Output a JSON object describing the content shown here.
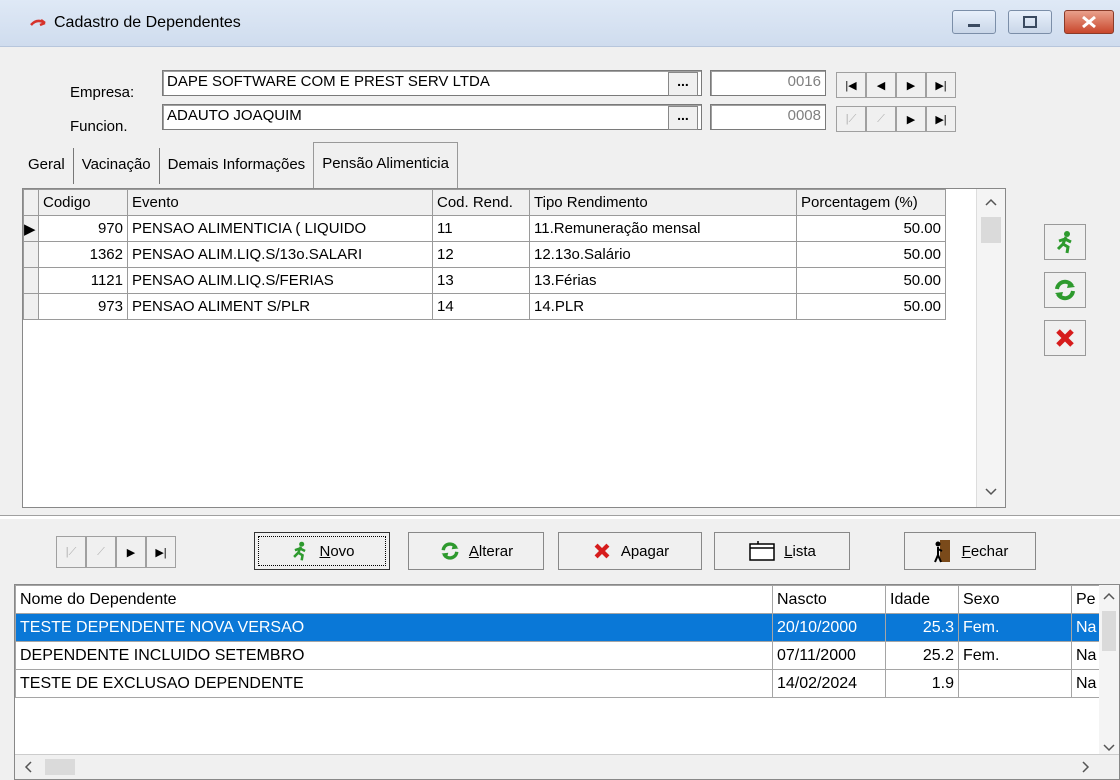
{
  "window": {
    "title": "Cadastro de Dependentes"
  },
  "header": {
    "empresa_label": "Empresa:",
    "empresa_value": "DAPE SOFTWARE COM E PREST SERV LTDA",
    "empresa_code": "0016",
    "funcion_label": "Funcion.",
    "funcion_value": "ADAUTO JOAQUIM",
    "funcion_code": "0008",
    "ellipsis": "..."
  },
  "tabs": [
    "Geral",
    "Vacinação",
    "Demais Informações",
    "Pensão Alimenticia"
  ],
  "pension_grid": {
    "columns": [
      "Codigo",
      "Evento",
      "Cod. Rend.",
      "Tipo Rendimento",
      "Porcentagem (%)"
    ],
    "rows": [
      [
        "970",
        "PENSAO ALIMENTICIA ( LIQUIDO",
        "11",
        "11.Remuneração mensal",
        "50.00"
      ],
      [
        "1362",
        "PENSAO ALIM.LIQ.S/13o.SALARI",
        "12",
        "12.13o.Salário",
        "50.00"
      ],
      [
        "1121",
        "PENSAO ALIM.LIQ.S/FERIAS",
        "13",
        "13.Férias",
        "50.00"
      ],
      [
        "973",
        "PENSAO ALIMENT S/PLR",
        "14",
        "14.PLR",
        "50.00"
      ]
    ]
  },
  "buttons": {
    "novo": "Novo",
    "alterar": "Alterar",
    "apagar": "Apagar",
    "lista": "Lista",
    "fechar": "Fechar"
  },
  "dependents_grid": {
    "columns": [
      "Nome do Dependente",
      "Nascto",
      "Idade",
      "Sexo",
      "Pe"
    ],
    "rows": [
      [
        "TESTE DEPENDENTE NOVA VERSAO",
        "20/10/2000",
        "25.3",
        "Fem.",
        "Na"
      ],
      [
        "DEPENDENTE INCLUIDO SETEMBRO",
        "07/11/2000",
        "25.2",
        "Fem.",
        "Na"
      ],
      [
        "TESTE DE EXCLUSAO DEPENDENTE",
        "14/02/2024",
        "1.9",
        "",
        "Na"
      ]
    ]
  },
  "colors": {
    "selection": "#0a78d7",
    "green_icon": "#2e9a2e",
    "red_icon": "#d61c1c"
  }
}
